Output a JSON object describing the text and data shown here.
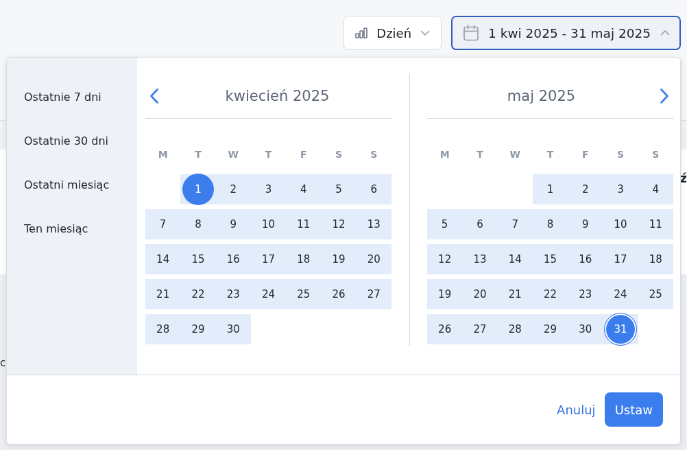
{
  "toolbar": {
    "period_button": {
      "label": "Dzień",
      "expanded": false
    },
    "date_range_button": {
      "label": "1 kwi 2025 - 31 maj 2025",
      "expanded": true
    }
  },
  "background": {
    "right_fragment": "ź",
    "left_fragment": "c"
  },
  "date_picker": {
    "presets": [
      "Ostatnie 7 dni",
      "Ostatnie 30 dni",
      "Ostatni miesiąc",
      "Ten miesiąc"
    ],
    "months": [
      {
        "title": "kwiecień 2025",
        "weekdays": [
          "M",
          "T",
          "W",
          "T",
          "F",
          "S",
          "S"
        ],
        "weeks": [
          [
            {
              "day": "1",
              "in_range": true,
              "selected": true,
              "focused": false
            },
            {
              "day": "2",
              "in_range": true,
              "selected": false,
              "focused": false
            },
            {
              "day": "3",
              "in_range": true,
              "selected": false,
              "focused": false
            },
            {
              "day": "4",
              "in_range": true,
              "selected": false,
              "focused": false
            },
            {
              "day": "5",
              "in_range": true,
              "selected": false,
              "focused": false
            },
            {
              "day": "6",
              "in_range": true,
              "selected": false,
              "focused": false
            }
          ],
          [
            {
              "day": "7",
              "in_range": true,
              "selected": false,
              "focused": false
            },
            {
              "day": "8",
              "in_range": true,
              "selected": false,
              "focused": false
            },
            {
              "day": "9",
              "in_range": true,
              "selected": false,
              "focused": false
            },
            {
              "day": "10",
              "in_range": true,
              "selected": false,
              "focused": false
            },
            {
              "day": "11",
              "in_range": true,
              "selected": false,
              "focused": false
            },
            {
              "day": "12",
              "in_range": true,
              "selected": false,
              "focused": false
            },
            {
              "day": "13",
              "in_range": true,
              "selected": false,
              "focused": false
            }
          ],
          [
            {
              "day": "14",
              "in_range": true,
              "selected": false,
              "focused": false
            },
            {
              "day": "15",
              "in_range": true,
              "selected": false,
              "focused": false
            },
            {
              "day": "16",
              "in_range": true,
              "selected": false,
              "focused": false
            },
            {
              "day": "17",
              "in_range": true,
              "selected": false,
              "focused": false
            },
            {
              "day": "18",
              "in_range": true,
              "selected": false,
              "focused": false
            },
            {
              "day": "19",
              "in_range": true,
              "selected": false,
              "focused": false
            },
            {
              "day": "20",
              "in_range": true,
              "selected": false,
              "focused": false
            }
          ],
          [
            {
              "day": "21",
              "in_range": true,
              "selected": false,
              "focused": false
            },
            {
              "day": "22",
              "in_range": true,
              "selected": false,
              "focused": false
            },
            {
              "day": "23",
              "in_range": true,
              "selected": false,
              "focused": false
            },
            {
              "day": "24",
              "in_range": true,
              "selected": false,
              "focused": false
            },
            {
              "day": "25",
              "in_range": true,
              "selected": false,
              "focused": false
            },
            {
              "day": "26",
              "in_range": true,
              "selected": false,
              "focused": false
            },
            {
              "day": "27",
              "in_range": true,
              "selected": false,
              "focused": false
            }
          ],
          [
            {
              "day": "28",
              "in_range": true,
              "selected": false,
              "focused": false
            },
            {
              "day": "29",
              "in_range": true,
              "selected": false,
              "focused": false
            },
            {
              "day": "30",
              "in_range": true,
              "selected": false,
              "focused": false
            }
          ]
        ]
      },
      {
        "title": "maj 2025",
        "weekdays": [
          "M",
          "T",
          "W",
          "T",
          "F",
          "S",
          "S"
        ],
        "weeks": [
          [
            {
              "day": "1",
              "in_range": true,
              "selected": false,
              "focused": false
            },
            {
              "day": "2",
              "in_range": true,
              "selected": false,
              "focused": false
            },
            {
              "day": "3",
              "in_range": true,
              "selected": false,
              "focused": false
            },
            {
              "day": "4",
              "in_range": true,
              "selected": false,
              "focused": false
            }
          ],
          [
            {
              "day": "5",
              "in_range": true,
              "selected": false,
              "focused": false
            },
            {
              "day": "6",
              "in_range": true,
              "selected": false,
              "focused": false
            },
            {
              "day": "7",
              "in_range": true,
              "selected": false,
              "focused": false
            },
            {
              "day": "8",
              "in_range": true,
              "selected": false,
              "focused": false
            },
            {
              "day": "9",
              "in_range": true,
              "selected": false,
              "focused": false
            },
            {
              "day": "10",
              "in_range": true,
              "selected": false,
              "focused": false
            },
            {
              "day": "11",
              "in_range": true,
              "selected": false,
              "focused": false
            }
          ],
          [
            {
              "day": "12",
              "in_range": true,
              "selected": false,
              "focused": false
            },
            {
              "day": "13",
              "in_range": true,
              "selected": false,
              "focused": false
            },
            {
              "day": "14",
              "in_range": true,
              "selected": false,
              "focused": false
            },
            {
              "day": "15",
              "in_range": true,
              "selected": false,
              "focused": false
            },
            {
              "day": "16",
              "in_range": true,
              "selected": false,
              "focused": false
            },
            {
              "day": "17",
              "in_range": true,
              "selected": false,
              "focused": false
            },
            {
              "day": "18",
              "in_range": true,
              "selected": false,
              "focused": false
            }
          ],
          [
            {
              "day": "19",
              "in_range": true,
              "selected": false,
              "focused": false
            },
            {
              "day": "20",
              "in_range": true,
              "selected": false,
              "focused": false
            },
            {
              "day": "21",
              "in_range": true,
              "selected": false,
              "focused": false
            },
            {
              "day": "22",
              "in_range": true,
              "selected": false,
              "focused": false
            },
            {
              "day": "23",
              "in_range": true,
              "selected": false,
              "focused": false
            },
            {
              "day": "24",
              "in_range": true,
              "selected": false,
              "focused": false
            },
            {
              "day": "25",
              "in_range": true,
              "selected": false,
              "focused": false
            }
          ],
          [
            {
              "day": "26",
              "in_range": true,
              "selected": false,
              "focused": false
            },
            {
              "day": "27",
              "in_range": true,
              "selected": false,
              "focused": false
            },
            {
              "day": "28",
              "in_range": true,
              "selected": false,
              "focused": false
            },
            {
              "day": "29",
              "in_range": true,
              "selected": false,
              "focused": false
            },
            {
              "day": "30",
              "in_range": true,
              "selected": false,
              "focused": false
            },
            {
              "day": "31",
              "in_range": true,
              "selected": true,
              "focused": true
            }
          ]
        ]
      }
    ],
    "actions": {
      "cancel": "Anuluj",
      "apply": "Ustaw"
    }
  }
}
